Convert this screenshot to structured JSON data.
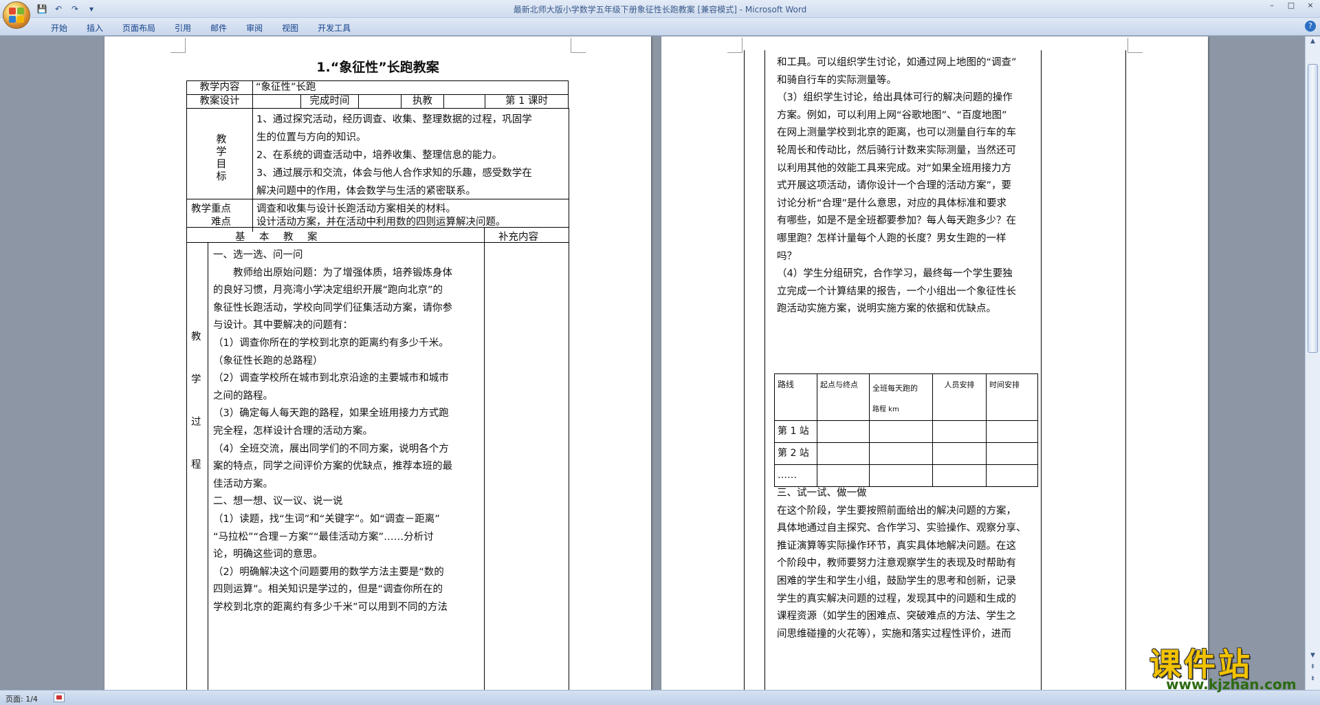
{
  "window": {
    "title": "最新北师大版小学数学五年级下册象征性长跑教案 [兼容模式] - Microsoft Word",
    "controls": [
      "–",
      "□",
      "×"
    ]
  },
  "ribbon": {
    "tabs": [
      "开始",
      "插入",
      "页面布局",
      "引用",
      "邮件",
      "审阅",
      "视图",
      "开发工具"
    ]
  },
  "status": {
    "page": "页面: 1/4"
  },
  "watermark": {
    "brand": "课件站",
    "url": "www.kjzhan.com"
  },
  "page1": {
    "title": "1.“象征性”长跑教案",
    "header": {
      "content_label": "教学内容",
      "content_value": "“象征性”长跑",
      "design_label": "教案设计",
      "time_label": "完成时间",
      "exec_label": "执教",
      "period": "第 1 课时"
    },
    "goals_label": "教学目标",
    "goals": [
      "1、通过探究活动，经历调查、收集、整理数据的过程，巩固学",
      "生的位置与方向的知识。",
      "2、在系统的调查活动中，培养收集、整理信息的能力。",
      "3、通过展示和交流，体会与他人合作求知的乐趣，感受数学在",
      "解决问题中的作用，体会数学与生活的紧密联系。"
    ],
    "key_label_1": "教学重点",
    "key_label_2": "难点",
    "key_1": "调查和收集与设计长跑活动方案相关的材料。",
    "key_2": "设计活动方案，并在活动中利用数的四则运算解决问题。",
    "basic_label": "基　本　教　案",
    "extra_label": "补充内容",
    "process_label": [
      "教",
      "学",
      "过",
      "程"
    ],
    "body": [
      "一、选一选、问一问",
      "　　教师给出原始问题：为了增强体质，培养锻炼身体",
      "的良好习惯，月亮湾小学决定组织开展“跑向北京”的",
      "象征性长跑活动，学校向同学们征集活动方案，请你参",
      "与设计。其中要解决的问题有：",
      "（1）调查你所在的学校到北京的距离约有多少千米。",
      "（象征性长跑的总路程）",
      "（2）调查学校所在城市到北京沿途的主要城市和城市",
      "之间的路程。",
      "（3）确定每人每天跑的路程，如果全班用接力方式跑",
      "完全程，怎样设计合理的活动方案。",
      "（4）全班交流，展出同学们的不同方案，说明各个方",
      "案的特点，同学之间评价方案的优缺点，推荐本班的最",
      "佳活动方案。",
      "二、想一想、议一议、说一说",
      "（1）读题，找“生词”和“关键字”。如“调查－距离”",
      "“马拉松”“合理－方案”“最佳活动方案”……分析讨",
      "论，明确这些词的意思。",
      "（2）明确解决这个问题要用的数学方法主要是“数的",
      "四则运算”。相关知识是学过的，但是“调查你所在的",
      "学校到北京的距离约有多少千米”可以用到不同的方法"
    ]
  },
  "page2": {
    "body_top": [
      "和工具。可以组织学生讨论，如通过网上地图的“调查”",
      "和骑自行车的实际测量等。",
      "（3）组织学生讨论，给出具体可行的解决问题的操作",
      "方案。例如，可以利用上网“谷歌地图”、“百度地图”",
      "在网上测量学校到北京的距离，也可以测量自行车的车",
      "轮周长和传动比，然后骑行计数来实际测量，当然还可",
      "以利用其他的效能工具来完成。对“如果全班用接力方",
      "式开展这项活动，请你设计一个合理的活动方案”，要",
      "讨论分析“合理”是什么意思，对应的具体标准和要求",
      "有哪些，如是不是全班都要参加？每人每天跑多少？在",
      "哪里跑？怎样计量每个人跑的长度？男女生跑的一样",
      "吗？",
      "（4）学生分组研究，合作学习，最终每一个学生要独",
      "立完成一个计算结果的报告，一个小组出一个象征性长",
      "跑活动实施方案，说明实施方案的依据和优缺点。"
    ],
    "table": {
      "headers": [
        "路线",
        "起点与终点",
        "全班每天跑的",
        "人员安排",
        "时间安排"
      ],
      "header_sub": "路程 km",
      "rows": [
        "第 1 站",
        "第 2 站",
        "……"
      ]
    },
    "body_bottom": [
      "三、试一试、做一做",
      "在这个阶段，学生要按照前面给出的解决问题的方案，",
      "具体地通过自主探究、合作学习、实验操作、观察分享、",
      "推证演算等实际操作环节，真实具体地解决问题。在这",
      "个阶段中，教师要努力注意观察学生的表现及时帮助有",
      "困难的学生和学生小组，鼓励学生的思考和创新，记录",
      "学生的真实解决问题的过程，发现其中的问题和生成的",
      "课程资源（如学生的困难点、突破难点的方法、学生之",
      "间思维碰撞的火花等），实施和落实过程性评价，进而"
    ]
  }
}
